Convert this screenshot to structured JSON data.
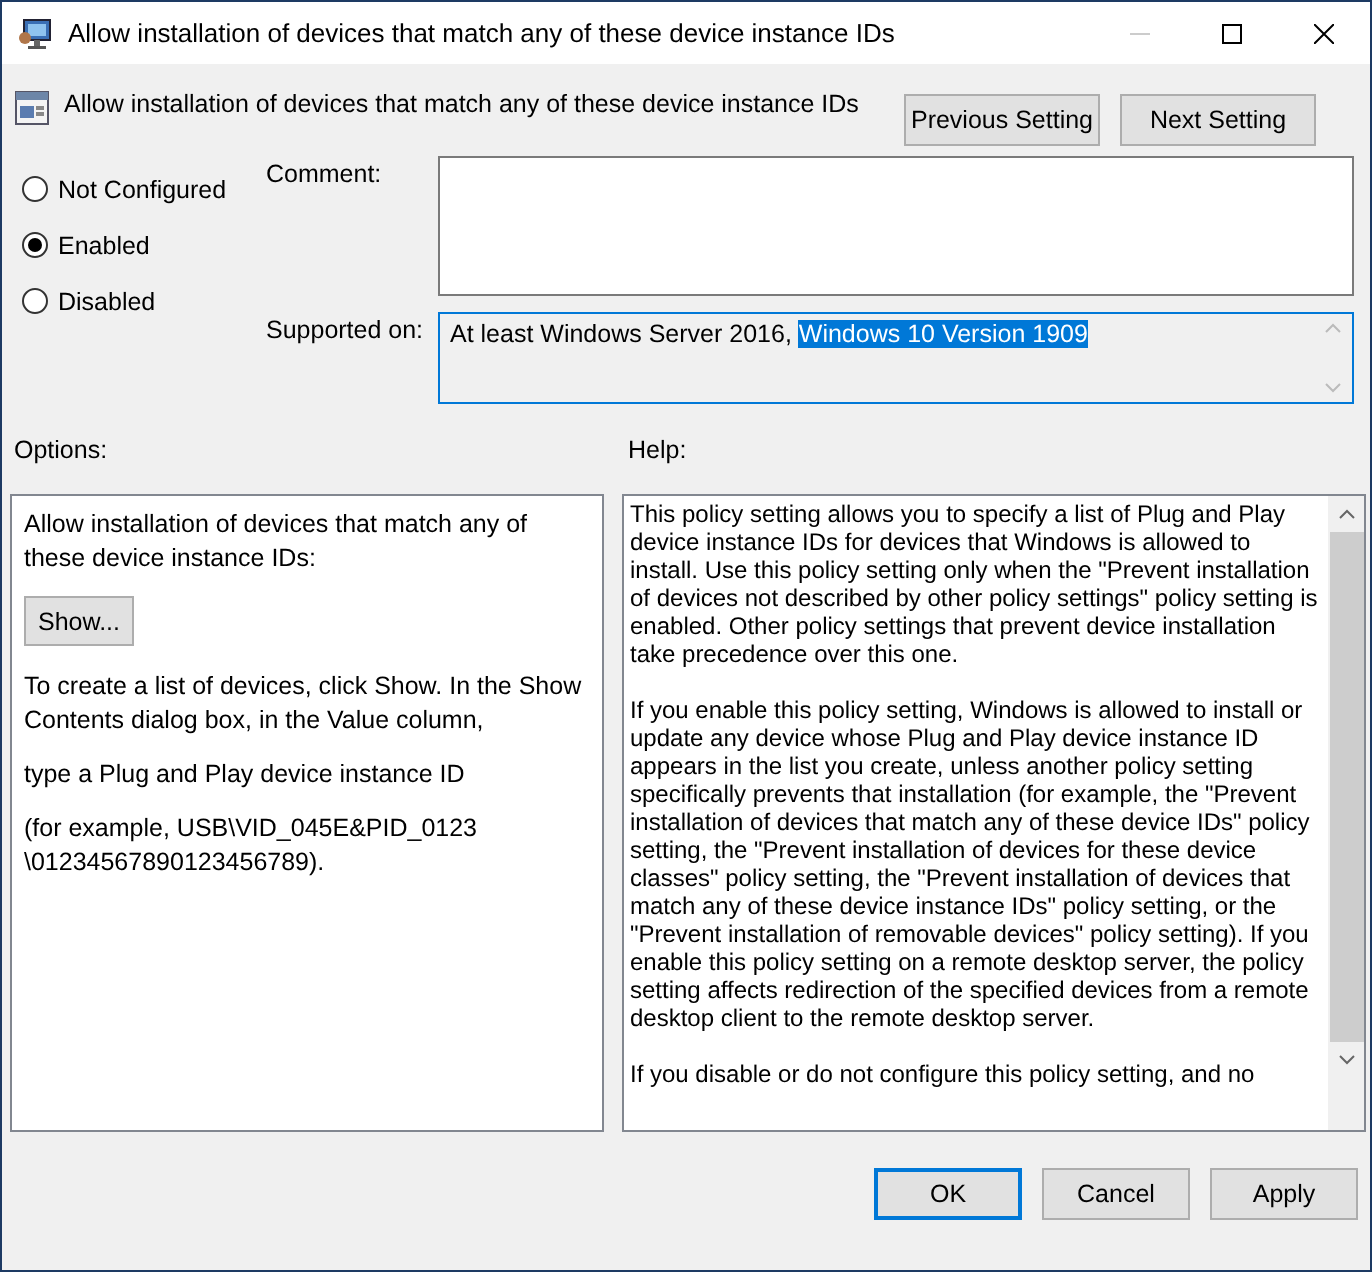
{
  "window": {
    "title": "Allow installation of devices that match any of these device instance IDs"
  },
  "header": {
    "title": "Allow installation of devices that match any of these device instance IDs",
    "buttons": [
      "Previous Setting",
      "Next Setting"
    ]
  },
  "state_options": [
    {
      "label": "Not Configured",
      "selected": false
    },
    {
      "label": "Enabled",
      "selected": true
    },
    {
      "label": "Disabled",
      "selected": false
    }
  ],
  "comment": {
    "label": "Comment:"
  },
  "supported_on": {
    "label": "Supported on:",
    "parts": [
      {
        "text": "At least Windows Server 2016, ",
        "selected": false
      },
      {
        "text": "Windows 10 Version 1909",
        "selected": true
      }
    ]
  },
  "options": {
    "label": "Options:",
    "items": [
      {
        "kind": "text",
        "text": "Allow installation of devices that match any of these device instance IDs:"
      },
      {
        "kind": "button",
        "text": "Show..."
      },
      {
        "kind": "text",
        "text": "To create a list of devices, click Show. In the Show Contents dialog box, in the Value column,"
      },
      {
        "kind": "text",
        "text": "type a Plug and Play device instance ID"
      },
      {
        "kind": "text",
        "text": "(for example, USB\\VID_045E&PID_0123 \\01234567890123456789)."
      }
    ]
  },
  "help": {
    "label": "Help:",
    "paragraphs": [
      "This policy setting allows you to specify a list of Plug and Play device instance IDs for devices that Windows is allowed to install. Use this policy setting only when the \"Prevent installation of devices not described by other policy settings\" policy setting is enabled. Other policy settings that prevent device installation take precedence over this one.",
      "If you enable this policy setting, Windows is allowed to install or update any device whose Plug and Play device instance ID appears in the list you create, unless another policy setting specifically prevents that installation (for example, the \"Prevent installation of devices that match any of these device IDs\" policy setting, the \"Prevent installation of devices for these device classes\" policy setting, the \"Prevent installation of devices that match any of these device instance IDs\" policy setting, or the \"Prevent installation of removable devices\" policy setting). If you enable this policy setting on a remote desktop server, the policy setting affects redirection of the specified devices from a remote desktop client to the remote desktop server.",
      "If you disable or do not configure this policy setting, and no"
    ]
  },
  "footer": {
    "buttons": [
      {
        "label": "OK",
        "selected": true
      },
      {
        "label": "Cancel",
        "selected": false
      },
      {
        "label": "Apply",
        "selected": false
      }
    ]
  }
}
